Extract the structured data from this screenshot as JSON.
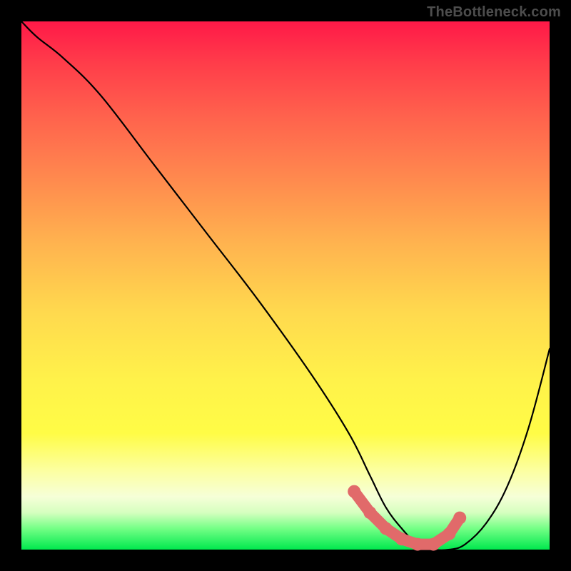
{
  "watermark": "TheBottleneck.com",
  "colors": {
    "marker": "#e16a6a",
    "curve": "#000000",
    "background_black": "#000000"
  },
  "chart_data": {
    "type": "line",
    "title": "",
    "xlabel": "",
    "ylabel": "",
    "xlim": [
      0,
      100
    ],
    "ylim": [
      0,
      100
    ],
    "grid": false,
    "legend": false,
    "series": [
      {
        "name": "bottleneck-curve",
        "x": [
          0,
          3,
          8,
          15,
          25,
          35,
          45,
          55,
          62,
          66,
          69,
          72,
          75,
          78,
          81,
          84,
          88,
          92,
          96,
          100
        ],
        "y": [
          100,
          97,
          93,
          86,
          73,
          60,
          47,
          33,
          22,
          14,
          8,
          4,
          1,
          0,
          0,
          1,
          5,
          12,
          23,
          38
        ]
      }
    ],
    "markers": {
      "name": "optimal-range",
      "x": [
        63,
        66,
        69,
        72,
        75,
        78,
        81,
        83
      ],
      "y": [
        11,
        7,
        4,
        2,
        1,
        1,
        3,
        6
      ]
    }
  }
}
